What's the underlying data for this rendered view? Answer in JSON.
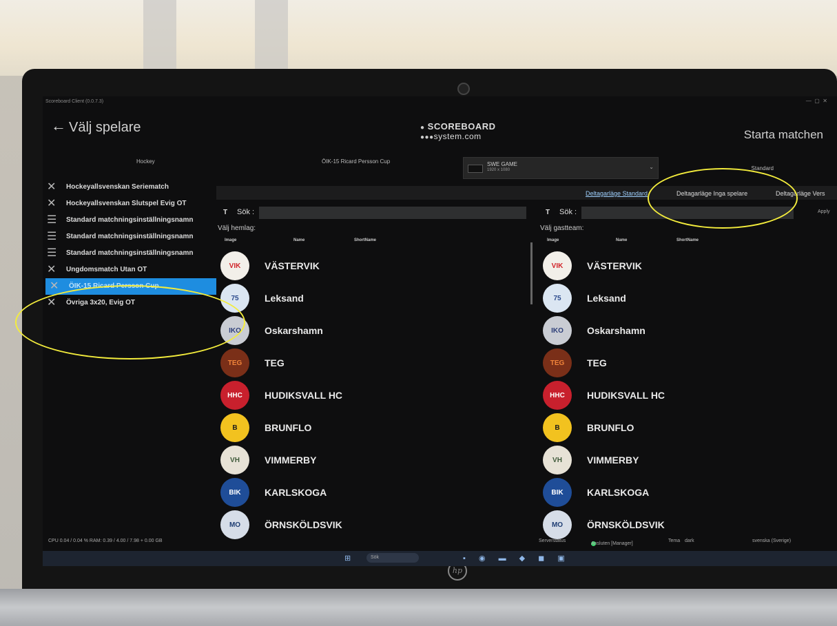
{
  "window": {
    "app_title": "Scoreboard Client (0.0.7.3)"
  },
  "header": {
    "back_icon": "arrow-left-icon",
    "title": "Välj spelare",
    "logo_line1": "SCOREBOARD",
    "logo_line2": "system.com",
    "start_button": "Starta matchen"
  },
  "settings_row": {
    "sport": "Hockey",
    "cup_name": "ÖIK-15 Ricard Persson Cup",
    "game_select_title": "SWE GAME",
    "game_select_sub": "1920 x 1080",
    "standard_label": "Standard"
  },
  "sidebar": {
    "items": [
      {
        "icon": "crossed-sticks-icon",
        "label": "Hockeyallsvenskan Seriematch",
        "active": false
      },
      {
        "icon": "crossed-sticks-icon",
        "label": "Hockeyallsvenskan Slutspel Evig OT",
        "active": false
      },
      {
        "icon": "list-icon",
        "label": "Standard matchningsinställningsnamn",
        "active": false
      },
      {
        "icon": "list-icon",
        "label": "Standard matchningsinställningsnamn",
        "active": false
      },
      {
        "icon": "list-icon",
        "label": "Standard matchningsinställningsnamn",
        "active": false
      },
      {
        "icon": "crossed-sticks-icon",
        "label": "Ungdomsmatch Utan OT",
        "active": false
      },
      {
        "icon": "crossed-sticks-icon",
        "label": "ÖIK-15 Ricard Persson Cup",
        "active": true
      },
      {
        "icon": "crossed-sticks-icon",
        "label": "Övriga 3x20, Evig OT",
        "active": false
      }
    ]
  },
  "mode_tabs": [
    "Deltagarläge Standard",
    "Deltagarläge Inga spelare",
    "Deltagarläge Vers"
  ],
  "home_panel": {
    "t_label": "T",
    "search_label": "Sök :",
    "search_value": "",
    "title": "Välj hemlag:",
    "columns": [
      "Image",
      "Name",
      "ShortName"
    ]
  },
  "away_panel": {
    "t_label": "T",
    "search_label": "Sök :",
    "search_value": "",
    "title": "Välj gastteam:",
    "columns": [
      "Image",
      "Name",
      "ShortName"
    ],
    "extra": "Apply"
  },
  "teams": [
    {
      "name": "VÄSTERVIK",
      "logo_text": "VIK",
      "bg": "#f2efe9",
      "fg": "#d1242a"
    },
    {
      "name": "Leksand",
      "logo_text": "75",
      "bg": "#dbe6f2",
      "fg": "#2b4a8c"
    },
    {
      "name": "Oskarshamn",
      "logo_text": "IKO",
      "bg": "#c9ccd3",
      "fg": "#2d3e78"
    },
    {
      "name": "TEG",
      "logo_text": "TEG",
      "bg": "#7a2f18",
      "fg": "#f0843a"
    },
    {
      "name": "HUDIKSVALL HC",
      "logo_text": "HHC",
      "bg": "#c8202d",
      "fg": "#ffffff"
    },
    {
      "name": "BRUNFLO",
      "logo_text": "B",
      "bg": "#f2c21f",
      "fg": "#1b1b1b"
    },
    {
      "name": "VIMMERBY",
      "logo_text": "VH",
      "bg": "#e7e2d6",
      "fg": "#3f5a3a"
    },
    {
      "name": "KARLSKOGA",
      "logo_text": "BIK",
      "bg": "#1f4d98",
      "fg": "#ffffff"
    },
    {
      "name": "ÖRNSKÖLDSVIK",
      "logo_text": "MO",
      "bg": "#d6dde8",
      "fg": "#1f3e74"
    }
  ],
  "status_bar": {
    "perf": "CPU 0.04 / 0.04 % RAM: 0.39 / 4.00 / 7.98 + 0.00 GB",
    "server_status": "Serverstatus",
    "connected": "Ansluten [Manager]",
    "theme_label": "Tema",
    "theme_value": "dark",
    "language": "svenska (Sverige)"
  },
  "taskbar": {
    "search_placeholder": "Sök"
  },
  "laptop_brand": "hp",
  "colors": {
    "accent": "#1e8de0",
    "highlight_circle": "#f3ec3c"
  }
}
